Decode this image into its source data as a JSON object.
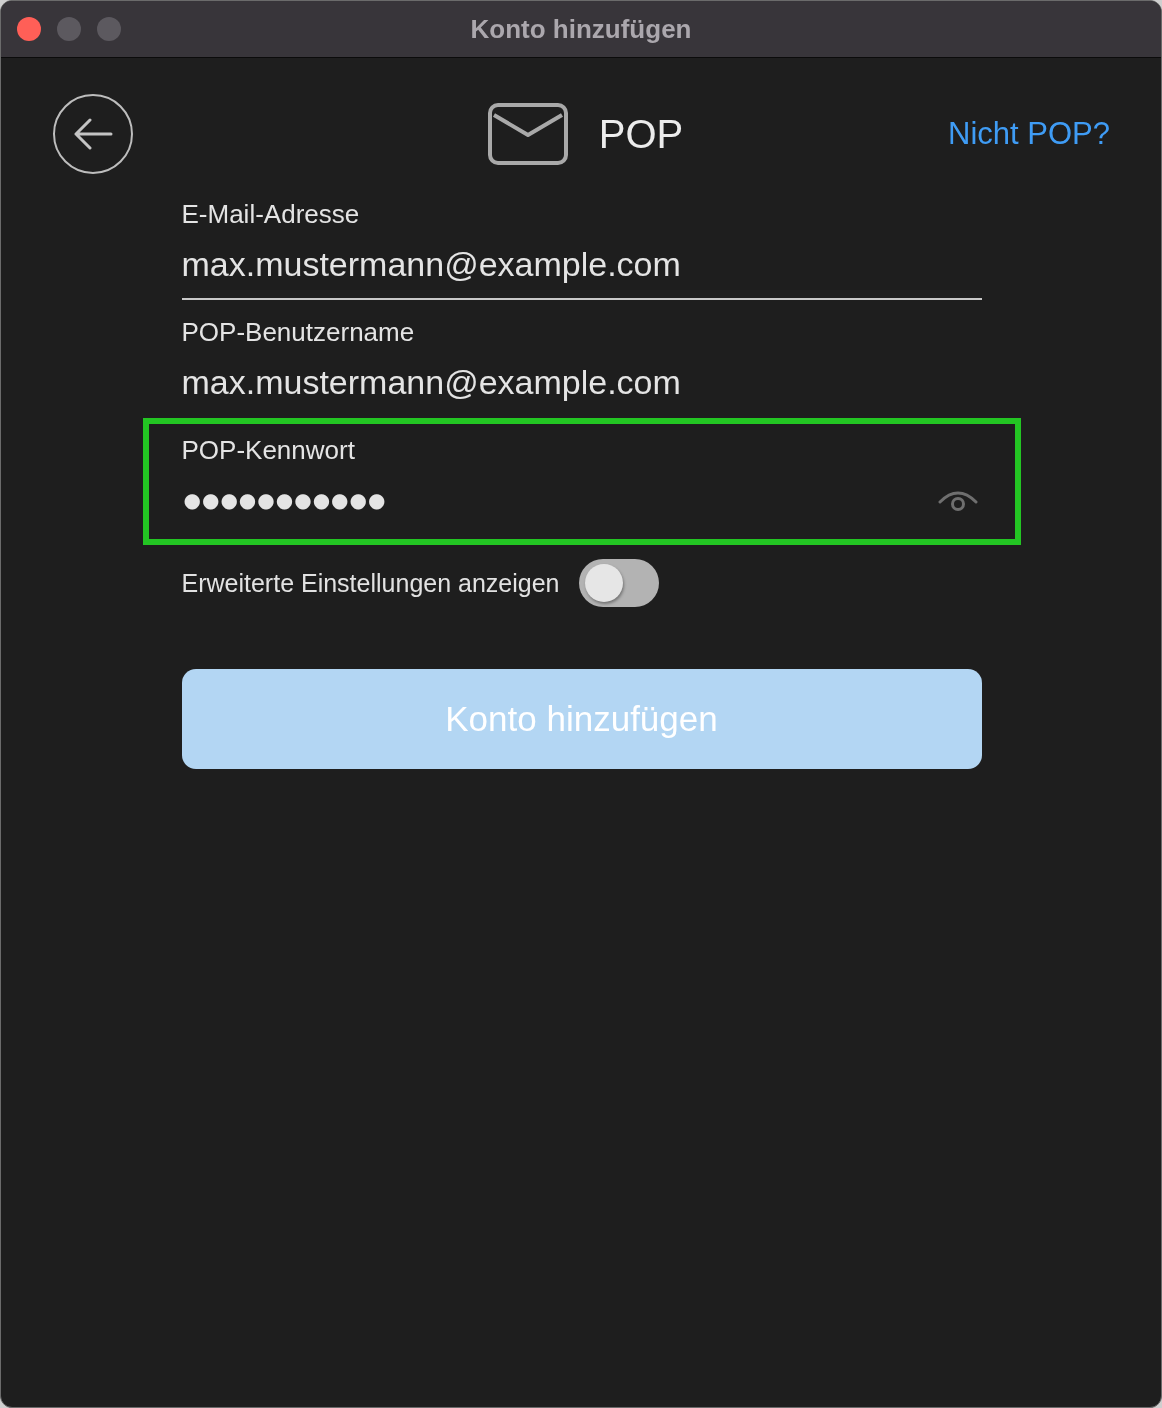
{
  "window": {
    "title": "Konto hinzufügen",
    "controls": [
      {
        "kind": "close",
        "disabled": false
      },
      {
        "kind": "minimize",
        "disabled": true
      },
      {
        "kind": "zoom",
        "disabled": true
      }
    ]
  },
  "header": {
    "protocol": "POP",
    "link": "Nicht POP?"
  },
  "fields": [
    {
      "kind": "text",
      "label": "E-Mail-Adresse",
      "value": "max.mustermann@example.com",
      "focused": true,
      "highlighted": false
    },
    {
      "kind": "text",
      "label": "POP-Benutzername",
      "value": "max.mustermann@example.com",
      "focused": false,
      "highlighted": false
    },
    {
      "kind": "password",
      "label": "POP-Kennwort",
      "value": "●●●●●●●●●●●",
      "focused": false,
      "highlighted": true
    }
  ],
  "advanced_toggle": {
    "label": "Erweiterte Einstellungen anzeigen",
    "on": false
  },
  "submit_button": {
    "label": "Konto hinzufügen",
    "disabled": true
  }
}
